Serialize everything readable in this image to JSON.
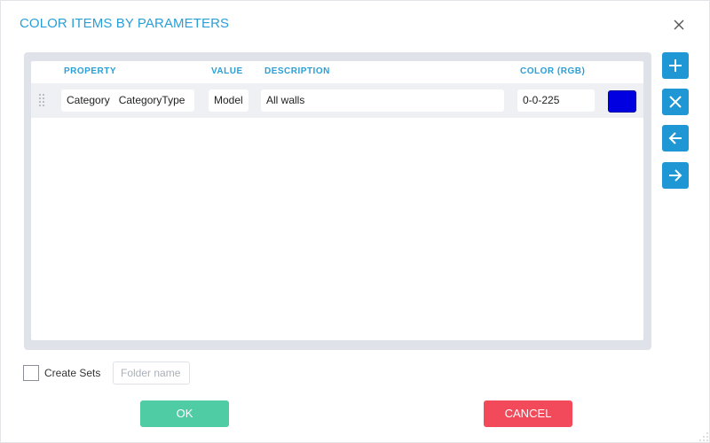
{
  "dialog": {
    "title": "COLOR ITEMS BY PARAMETERS",
    "close_icon": "close-icon"
  },
  "table": {
    "headers": {
      "property": "PROPERTY",
      "value": "VALUE",
      "description": "DESCRIPTION",
      "color": "COLOR (RGB)"
    },
    "rows": [
      {
        "property_category": "Category",
        "property_name": "CategoryType",
        "value": "Model",
        "description": "All walls",
        "color_rgb": "0-0-225",
        "swatch_color": "#0000e1"
      }
    ]
  },
  "side_buttons": [
    {
      "icon": "plus-icon"
    },
    {
      "icon": "x-icon"
    },
    {
      "icon": "arrow-left-icon"
    },
    {
      "icon": "arrow-right-icon"
    }
  ],
  "footer": {
    "create_sets_label": "Create Sets",
    "create_sets_checked": false,
    "folder_placeholder": "Folder name",
    "ok_label": "OK",
    "cancel_label": "CANCEL"
  },
  "colors": {
    "accent": "#2a9fd6",
    "button_blue": "#1f97d4",
    "ok_green": "#4fcca4",
    "cancel_red": "#f24a5b"
  }
}
